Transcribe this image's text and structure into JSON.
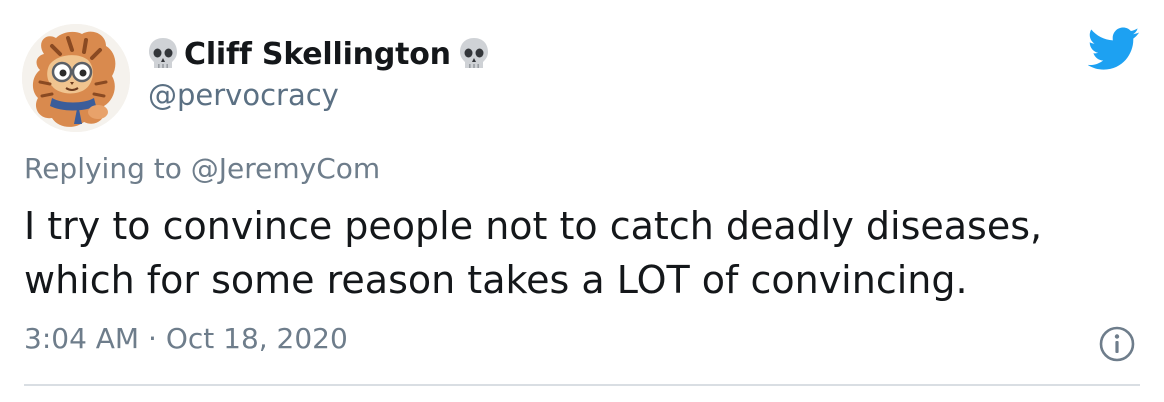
{
  "user": {
    "display_name": "Cliff Skellington",
    "handle": "@pervocracy",
    "name_emoji": "skull-icon"
  },
  "reply": {
    "prefix": "Replying to",
    "mention": "@JeremyCom"
  },
  "tweet": {
    "line1": "I try to convince people not to catch deadly diseases,",
    "line2": "which for some reason takes a LOT of convincing."
  },
  "meta": {
    "time": "3:04 AM",
    "separator": "·",
    "date": "Oct 18, 2020"
  },
  "colors": {
    "brand": "#1da1f2",
    "text": "#14171a",
    "secondary": "#6e7d8b",
    "divider": "#d9dee3"
  }
}
